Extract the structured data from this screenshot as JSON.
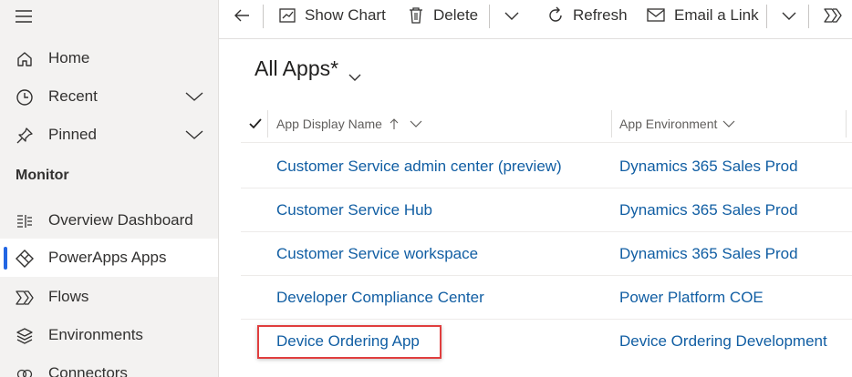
{
  "sidebar": {
    "items": [
      {
        "label": "Home",
        "icon": "home-icon"
      },
      {
        "label": "Recent",
        "icon": "clock-icon"
      },
      {
        "label": "Pinned",
        "icon": "pin-icon"
      }
    ],
    "section_title": "Monitor",
    "monitor_items": [
      {
        "label": "Overview Dashboard",
        "icon": "dashboard-icon"
      },
      {
        "label": "PowerApps Apps",
        "icon": "powerapps-icon",
        "selected": true
      },
      {
        "label": "Flows",
        "icon": "flows-icon"
      },
      {
        "label": "Environments",
        "icon": "layers-icon"
      },
      {
        "label": "Connectors",
        "icon": "connector-icon"
      }
    ]
  },
  "toolbar": {
    "show_chart": "Show Chart",
    "delete": "Delete",
    "refresh": "Refresh",
    "email_link": "Email a Link"
  },
  "view": {
    "title": "All Apps*"
  },
  "grid": {
    "columns": [
      "App Display Name",
      "App Environment"
    ],
    "rows": [
      {
        "name": "Customer Service admin center (preview)",
        "environment": "Dynamics 365 Sales Prod"
      },
      {
        "name": "Customer Service Hub",
        "environment": "Dynamics 365 Sales Prod"
      },
      {
        "name": "Customer Service workspace",
        "environment": "Dynamics 365 Sales Prod"
      },
      {
        "name": "Developer Compliance Center",
        "environment": "Power Platform COE"
      },
      {
        "name": "Device Ordering App",
        "environment": "Device Ordering Development"
      }
    ]
  },
  "colors": {
    "link": "#115ea3",
    "accent": "#2266e3",
    "highlight": "#e03e3e",
    "sidebar_bg": "#f3f2f1"
  }
}
